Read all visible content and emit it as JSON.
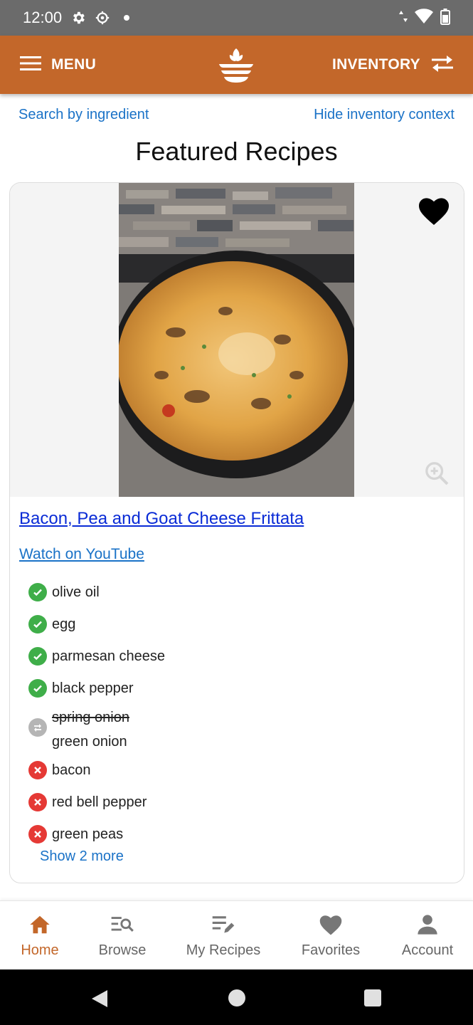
{
  "status_bar": {
    "time": "12:00"
  },
  "app_bar": {
    "menu_label": "MENU",
    "inventory_label": "INVENTORY",
    "accent_color": "#c3672a"
  },
  "links": {
    "search_by_ingredient": "Search by ingredient",
    "hide_inventory_context": "Hide inventory context"
  },
  "page_title": "Featured Recipes",
  "recipe": {
    "title": "Bacon, Pea and Goat Cheese Frittata",
    "youtube_link": "Watch on YouTube",
    "favorited": true,
    "ingredients": [
      {
        "name": "olive oil",
        "status": "have"
      },
      {
        "name": "egg",
        "status": "have"
      },
      {
        "name": "parmesan cheese",
        "status": "have"
      },
      {
        "name": "black pepper",
        "status": "have"
      },
      {
        "name": "spring onion",
        "substitute": "green onion",
        "status": "substitute"
      },
      {
        "name": "bacon",
        "status": "missing"
      },
      {
        "name": "red bell pepper",
        "status": "missing"
      },
      {
        "name": "green peas",
        "status": "missing"
      }
    ],
    "show_more": "Show 2 more"
  },
  "bottom_nav": {
    "items": [
      {
        "label": "Home",
        "active": true
      },
      {
        "label": "Browse",
        "active": false
      },
      {
        "label": "My Recipes",
        "active": false
      },
      {
        "label": "Favorites",
        "active": false
      },
      {
        "label": "Account",
        "active": false
      }
    ]
  },
  "colors": {
    "have": "#3fae49",
    "missing": "#e53935",
    "substitute": "#b5b5b5",
    "link": "#1a72c7"
  }
}
